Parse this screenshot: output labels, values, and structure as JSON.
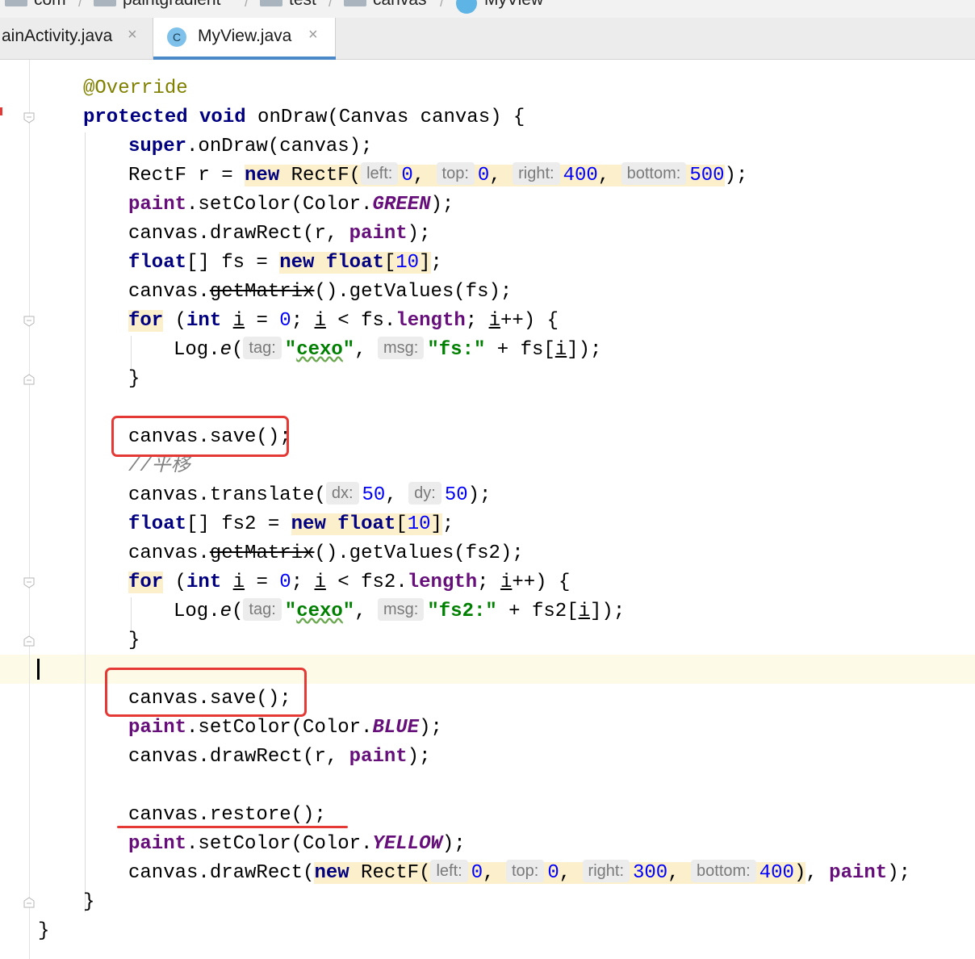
{
  "breadcrumb": [
    {
      "label": "com"
    },
    {
      "label": "paintgradient"
    },
    {
      "label": "test"
    },
    {
      "label": "canvas"
    },
    {
      "label": "MyView"
    }
  ],
  "tabs": [
    {
      "label": "ainActivity.java",
      "close": "×"
    },
    {
      "label": "MyView.java",
      "icon": "C",
      "close": "×",
      "active": true
    }
  ],
  "code": {
    "l1": {
      "ann": "@Override"
    },
    "l2": {
      "k1": "protected",
      "k2": "void",
      "t1": " onDraw(Canvas canvas) {"
    },
    "l3": {
      "k1": "super",
      "t1": ".onDraw(canvas);"
    },
    "l4": {
      "t1": "RectF r = ",
      "k1": "new",
      "t2": " RectF(",
      "h1": "left:",
      "n1": "0",
      "c1": ", ",
      "h2": "top:",
      "n2": "0",
      "c2": ", ",
      "h3": "right:",
      "n3": "400",
      "c3": ", ",
      "h4": "bottom:",
      "n4": "500",
      "t3": ");"
    },
    "l5": {
      "f1": "paint",
      "t1": ".setColor(Color.",
      "s1": "GREEN",
      "t2": ");"
    },
    "l6": {
      "t1": "canvas.drawRect(r, ",
      "f1": "paint",
      "t2": ");"
    },
    "l7": {
      "k1": "float",
      "t1": "[] fs = ",
      "k2": "new",
      "sp": " ",
      "k3": "float",
      "t2": "[",
      "n1": "10",
      "t3": "]",
      "t4": ";"
    },
    "l8": {
      "t1": "canvas.",
      "st": "getMatrix",
      "t2": "().getValues(fs);"
    },
    "l9": {
      "k1": "for",
      "t1": " (",
      "k2": "int",
      "sp1": " ",
      "u1": "i",
      "t2": " = ",
      "n1": "0",
      "t3": "; ",
      "u2": "i",
      "t4": " < fs.",
      "f1": "length",
      "t5": "; ",
      "u3": "i",
      "t6": "++) {"
    },
    "l10": {
      "t1": "Log.",
      "i1": "e",
      "t2": "(",
      "h1": "tag:",
      "s1": "\"",
      "w1": "cexo",
      "s2": "\"",
      "t3": ", ",
      "h2": "msg:",
      "s3": "\"fs:\"",
      "t4": " + fs[",
      "u1": "i",
      "t5": "]);"
    },
    "l11": {
      "t1": "}"
    },
    "l12": {
      "t1": "canvas.save();"
    },
    "l13": {
      "c1": "//平移"
    },
    "l14": {
      "t1": "canvas.translate(",
      "h1": "dx:",
      "n1": "50",
      "c1": ", ",
      "h2": "dy:",
      "n2": "50",
      "t2": ");"
    },
    "l15": {
      "k1": "float",
      "t1": "[] fs2 = ",
      "k2": "new",
      "sp": " ",
      "k3": "float",
      "t2": "[",
      "n1": "10",
      "t3": "]",
      "t4": ";"
    },
    "l16": {
      "t1": "canvas.",
      "st": "getMatrix",
      "t2": "().getValues(fs2);"
    },
    "l17": {
      "k1": "for",
      "t1": " (",
      "k2": "int",
      "sp1": " ",
      "u1": "i",
      "t2": " = ",
      "n1": "0",
      "t3": "; ",
      "u2": "i",
      "t4": " < fs2.",
      "f1": "length",
      "t5": "; ",
      "u3": "i",
      "t6": "++) {"
    },
    "l18": {
      "t1": "Log.",
      "i1": "e",
      "t2": "(",
      "h1": "tag:",
      "s1": "\"",
      "w1": "cexo",
      "s2": "\"",
      "t3": ", ",
      "h2": "msg:",
      "s3": "\"fs2:\"",
      "t4": " + fs2[",
      "u1": "i",
      "t5": "]);"
    },
    "l19": {
      "t1": "}"
    },
    "l20": {
      "t1": "canvas.save();"
    },
    "l21": {
      "f1": "paint",
      "t1": ".setColor(Color.",
      "s1": "BLUE",
      "t2": ");"
    },
    "l22": {
      "t1": "canvas.drawRect(r, ",
      "f1": "paint",
      "t2": ");"
    },
    "l23": {
      "t1": "canvas.restore();"
    },
    "l24": {
      "f1": "paint",
      "t1": ".setColor(Color.",
      "s1": "YELLOW",
      "t2": ");"
    },
    "l25": {
      "t1": "canvas.drawRect(",
      "k1": "new",
      "t2": " RectF(",
      "h1": "left:",
      "n1": "0",
      "c1": ", ",
      "h2": "top:",
      "n2": "0",
      "c2": ", ",
      "h3": "right:",
      "n3": "300",
      "c3": ", ",
      "h4": "bottom:",
      "n4": "400",
      "t3": ")",
      "t4": ", ",
      "f2": "paint",
      "t5": ");"
    },
    "l26": {
      "t1": "}"
    },
    "l27": {
      "t1": "}"
    }
  },
  "colors": {
    "keyword": "#000080",
    "field": "#660e7a",
    "number": "#0000ff",
    "string": "#008000",
    "annotation": "#808000",
    "comment": "#808080",
    "highlight": "#fbf0cb",
    "annotation_box": "#e53935",
    "active_tab_underline": "#4a88c7"
  }
}
